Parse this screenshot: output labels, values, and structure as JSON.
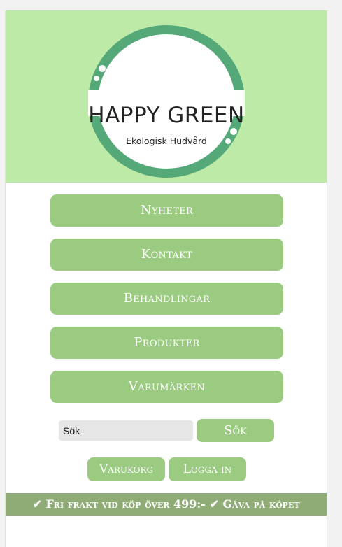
{
  "logo": {
    "title": "HAPPY GREEN",
    "subtitle": "Ekologisk Hudvård",
    "ring_color": "#55a878"
  },
  "nav": {
    "items": [
      {
        "label": "Nyheter"
      },
      {
        "label": "Kontakt"
      },
      {
        "label": "Behandlingar"
      },
      {
        "label": "Produkter"
      },
      {
        "label": "Varumärken"
      }
    ]
  },
  "search": {
    "value": "Sök",
    "button_label": "Sök"
  },
  "actions": {
    "cart_label": "Varukorg",
    "login_label": "Logga in"
  },
  "banner": {
    "text": "✔ Fri frakt vid köp över 499:- ✔ Gåva på köpet"
  },
  "colors": {
    "header_bg": "#bdeaa7",
    "button_bg": "#9bcb80",
    "banner_bg": "#8fac77"
  }
}
